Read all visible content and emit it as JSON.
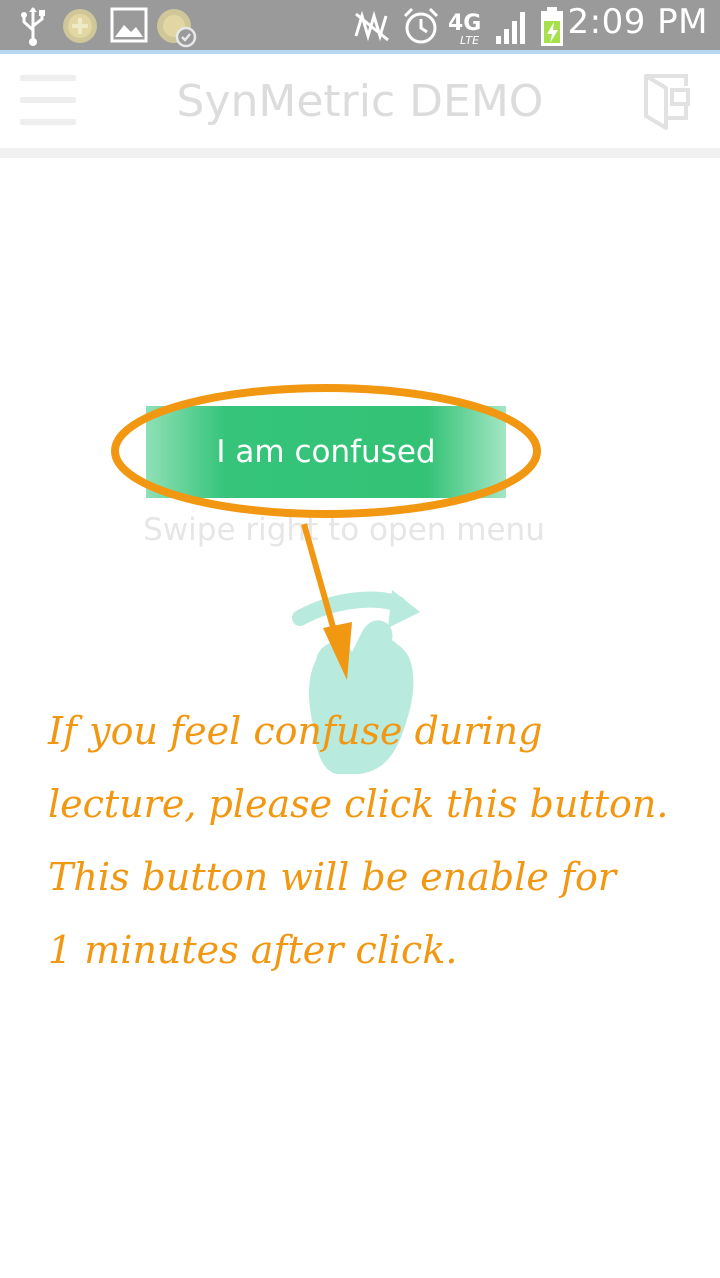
{
  "status_bar": {
    "time": "2:09 PM",
    "network": "4G LTE",
    "icons": [
      "usb-icon",
      "app-notification-icon",
      "image-icon",
      "app-sync-icon",
      "no-signal-icon",
      "alarm-icon",
      "4g-lte-icon",
      "signal-bars-icon",
      "battery-charging-icon"
    ]
  },
  "action_bar": {
    "title": "SynMetric DEMO",
    "menu_icon": "hamburger-icon",
    "exit_icon": "exit-door-icon"
  },
  "main": {
    "button_label": "I am confused",
    "swipe_hint": "Swipe right to open menu",
    "gesture_icon": "swipe-hand-icon"
  },
  "annotation": {
    "lines": [
      "If you feel confuse during",
      "lecture, please click this button.",
      "This button will be enable for",
      "1 minutes after click."
    ]
  },
  "colors": {
    "status_bar_bg": "#9a9a9a",
    "button_green": "#33c276",
    "annotation_orange": "#f29711",
    "gesture_mint": "#b3e9dc"
  }
}
